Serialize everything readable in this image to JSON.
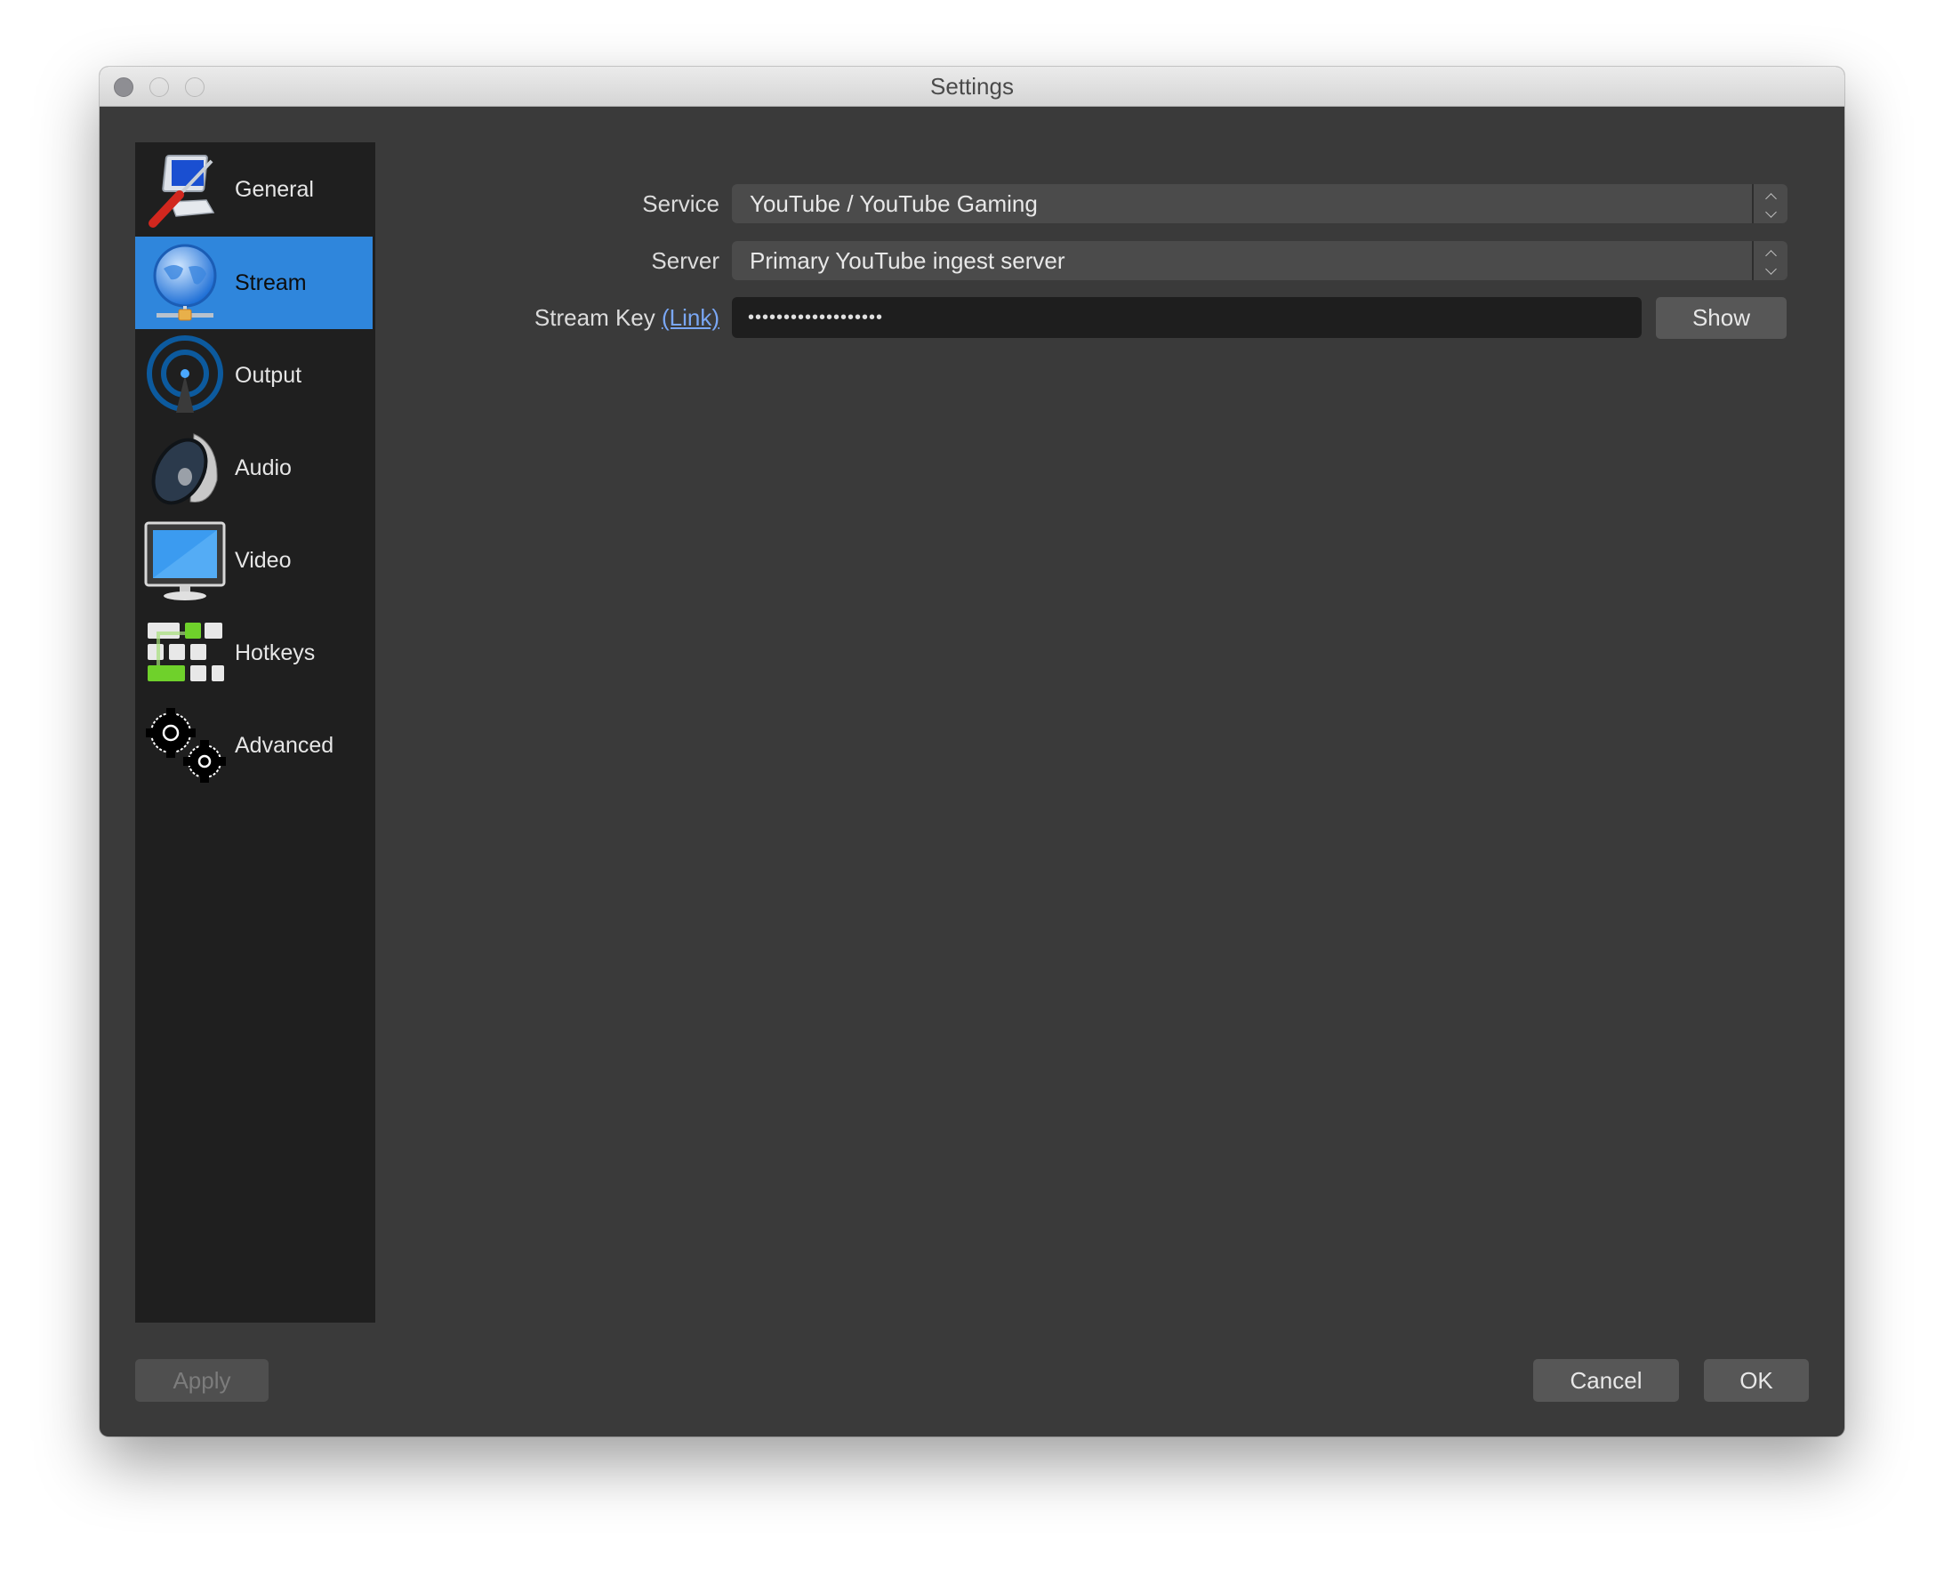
{
  "window": {
    "title": "Settings",
    "controls": [
      "close",
      "minimize",
      "zoom"
    ]
  },
  "sidebar": {
    "selected": "Stream",
    "accent": "#2f86dc",
    "items": [
      {
        "label": "General",
        "icon": "monitor-screwdriver-icon"
      },
      {
        "label": "Stream",
        "icon": "globe-network-icon"
      },
      {
        "label": "Output",
        "icon": "broadcast-antenna-icon"
      },
      {
        "label": "Audio",
        "icon": "speaker-icon"
      },
      {
        "label": "Video",
        "icon": "display-monitor-icon"
      },
      {
        "label": "Hotkeys",
        "icon": "keyboard-keys-icon"
      },
      {
        "label": "Advanced",
        "icon": "gears-icon"
      }
    ]
  },
  "stream": {
    "service_label": "Service",
    "service_value": "YouTube / YouTube Gaming",
    "server_label": "Server",
    "server_value": "Primary YouTube ingest server",
    "key_label": "Stream Key",
    "key_link": "(Link)",
    "key_value_masked": "•••••••••••••••••••",
    "show_button": "Show"
  },
  "footer": {
    "apply": "Apply",
    "cancel": "Cancel",
    "ok": "OK"
  }
}
